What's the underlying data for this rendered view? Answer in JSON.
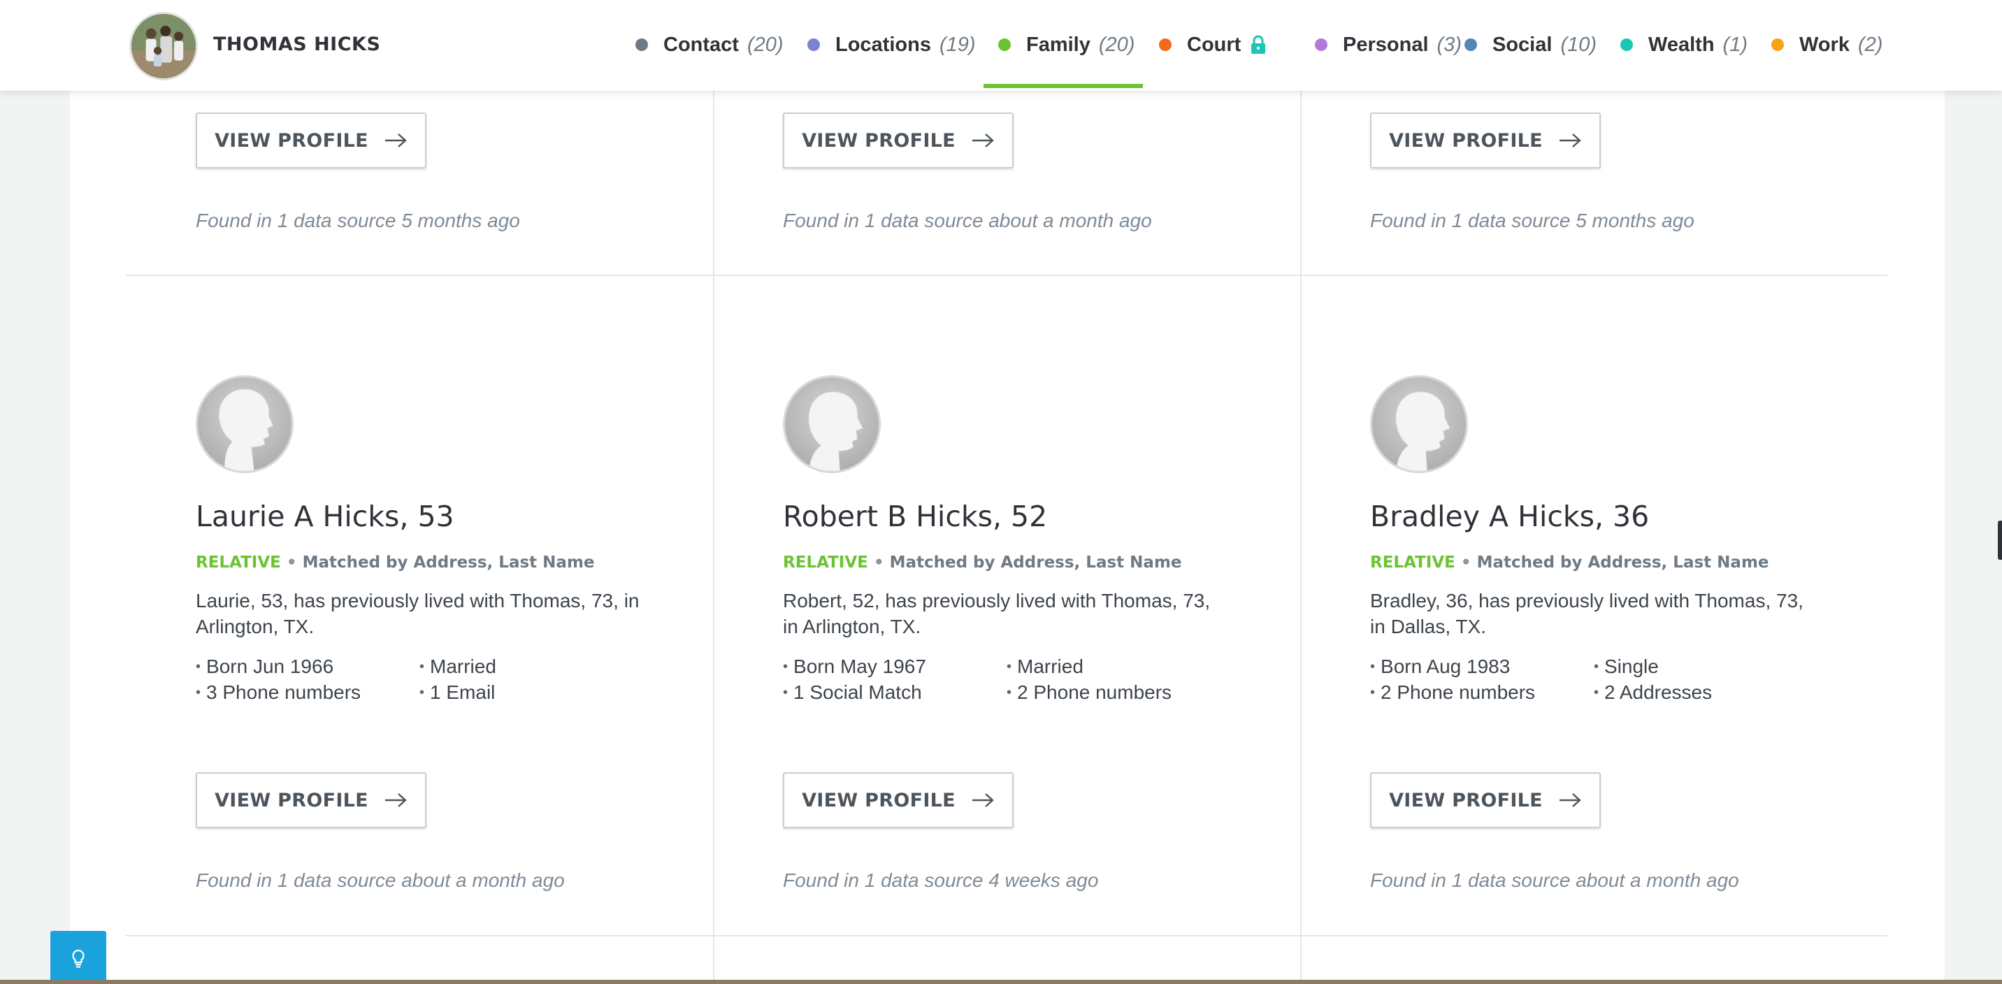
{
  "header": {
    "owner_name": "THOMAS HICKS",
    "nav": [
      {
        "label": "Contact",
        "count": "(20)",
        "color": "#6e7a86"
      },
      {
        "label": "Locations",
        "count": "(19)",
        "color": "#7b82d6"
      },
      {
        "label": "Family",
        "count": "(20)",
        "color": "#6cc332",
        "active": true
      },
      {
        "label": "Court",
        "count": "",
        "color": "#f26a1b",
        "locked": true
      },
      {
        "label": "Personal",
        "count": "(3)",
        "color": "#b57ad9"
      },
      {
        "label": "Social",
        "count": "(10)",
        "color": "#5585b5"
      },
      {
        "label": "Wealth",
        "count": "(1)",
        "color": "#1cc6b5"
      },
      {
        "label": "Work",
        "count": "(2)",
        "color": "#f5a21b"
      }
    ]
  },
  "top_row": [
    {
      "button_label": "VIEW PROFILE",
      "found": "Found in 1 data source 5 months ago"
    },
    {
      "button_label": "VIEW PROFILE",
      "found": "Found in 1 data source about a month ago"
    },
    {
      "button_label": "VIEW PROFILE",
      "found": "Found in 1 data source 5 months ago"
    }
  ],
  "people": [
    {
      "name": "Laurie A Hicks, 53",
      "relation": "RELATIVE",
      "matched_by": "Matched by Address, Last Name",
      "description": "Laurie, 53, has previously lived with Thomas, 73, in Arlington, TX.",
      "facts_left": [
        "Born Jun 1966",
        "3 Phone numbers"
      ],
      "facts_right": [
        "Married",
        "1 Email"
      ],
      "button_label": "VIEW PROFILE",
      "found": "Found in 1 data source about a month ago",
      "avatar": "female-silhouette-icon"
    },
    {
      "name": "Robert B Hicks, 52",
      "relation": "RELATIVE",
      "matched_by": "Matched by Address, Last Name",
      "description": "Robert, 52, has previously lived with Thomas, 73, in Arlington, TX.",
      "facts_left": [
        "Born May 1967",
        "1 Social Match"
      ],
      "facts_right": [
        "Married",
        "2 Phone numbers"
      ],
      "button_label": "VIEW PROFILE",
      "found": "Found in 1 data source 4 weeks ago",
      "avatar": "male-silhouette-icon"
    },
    {
      "name": "Bradley A Hicks, 36",
      "relation": "RELATIVE",
      "matched_by": "Matched by Address, Last Name",
      "description": "Bradley, 36, has previously lived with Thomas, 73, in Dallas, TX.",
      "facts_left": [
        "Born Aug 1983",
        "2 Phone numbers"
      ],
      "facts_right": [
        "Single",
        "2 Addresses"
      ],
      "button_label": "VIEW PROFILE",
      "found": "Found in 1 data source about a month ago",
      "avatar": "male-silhouette-icon"
    }
  ],
  "colors": {
    "accent_green": "#6cc332",
    "help_blue": "#1aa2dd",
    "lock_teal": "#1cc6b5"
  },
  "help": {
    "icon": "lightbulb-icon"
  }
}
